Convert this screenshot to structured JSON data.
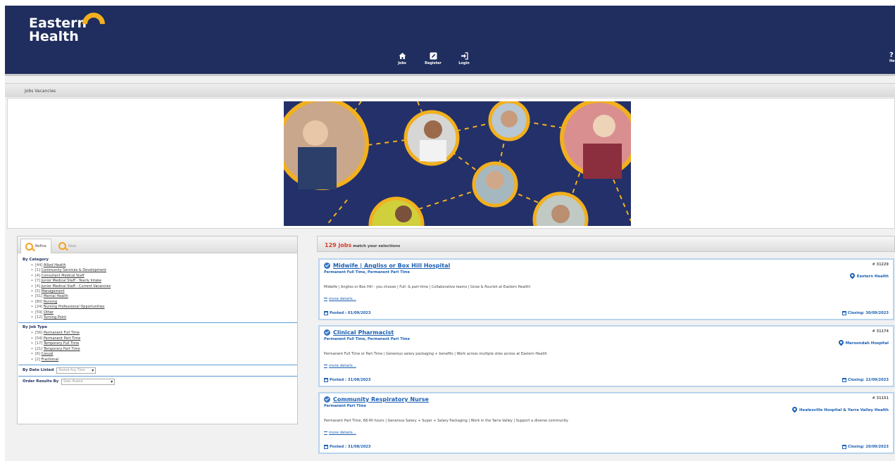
{
  "brand": {
    "line1": "Eastern",
    "line2": "Health",
    "accent": "#f2b01e",
    "navy": "#1f2e5e"
  },
  "nav": [
    {
      "label": "Jobs",
      "icon": "home-icon"
    },
    {
      "label": "Register",
      "icon": "edit-icon"
    },
    {
      "label": "Login",
      "icon": "login-icon"
    }
  ],
  "help": {
    "glyph": "?",
    "label": "He"
  },
  "section": {
    "title": "Jobs Vacancies"
  },
  "filters": {
    "tabs": [
      {
        "label": "Refine"
      },
      {
        "label": "New"
      }
    ],
    "category_head": "By Category",
    "categories": [
      {
        "count": "[44]",
        "label": "Allied Health"
      },
      {
        "count": "[1]",
        "label": "Community Services & Development"
      },
      {
        "count": "[4]",
        "label": "Consultant Medical Staff"
      },
      {
        "count": "[7]",
        "label": "Junior Medical Staff - Yearly Intake"
      },
      {
        "count": "[4]",
        "label": "Junior Medical Staff - Current Vacancies"
      },
      {
        "count": "[5]",
        "label": "Management"
      },
      {
        "count": "[51]",
        "label": "Mental Health"
      },
      {
        "count": "[80]",
        "label": "Nursing"
      },
      {
        "count": "[24]",
        "label": "Nursing Professional Opportunities"
      },
      {
        "count": "[59]",
        "label": "Other"
      },
      {
        "count": "[12]",
        "label": "Turning Point"
      }
    ],
    "jobtype_head": "By Job Type",
    "jobtypes": [
      {
        "count": "[56]",
        "label": "Permanent Full Time"
      },
      {
        "count": "[54]",
        "label": "Permanent Part Time"
      },
      {
        "count": "[17]",
        "label": "Temporary Full Time"
      },
      {
        "count": "[21]",
        "label": "Temporary Part Time"
      },
      {
        "count": "[6]",
        "label": "Casual"
      },
      {
        "count": "[2]",
        "label": "Fractional"
      }
    ],
    "date_listed_label": "By Date Listed",
    "date_listed_value": "Posted Any Time",
    "order_label": "Order Results By",
    "order_value": "Date Posted"
  },
  "results": {
    "count": "129 jobs",
    "suffix": " match your selections"
  },
  "jobs": [
    {
      "title": "Midwife | Angliss or Box Hill Hospital",
      "type": "Permanent Full Time, Permanent Part Time",
      "desc": "Midwife | Angliss or Box Hill - you choose | Full- & part-time | Collaborative teams | Grow & flourish at Eastern Health!",
      "more": "more details...",
      "posted": "Posted : 01/09/2023",
      "closing": "Closing: 30/09/2023",
      "ref": "# 31229",
      "location": "Eastern Health"
    },
    {
      "title": "Clinical Pharmacist",
      "type": "Permanent Full Time, Permanent Part Time",
      "desc": "Permanent Full Time or Part Time | Generous salary packaging + benefits | Work across multiple sites across at Eastern Health",
      "more": "more details...",
      "posted": "Posted : 31/08/2023",
      "closing": "Closing: 22/09/2023",
      "ref": "# 31174",
      "location": "Maroondah Hospital"
    },
    {
      "title": "Community Respiratory Nurse",
      "type": "Permanent Part Time",
      "desc": "Permanent Part Time, 68.40 hours | Generous Salary + Super + Salary Packaging | Work in the Yarra Valley | Support a diverse community",
      "more": "more details...",
      "posted": "Posted : 31/08/2023",
      "closing": "Closing: 20/09/2023",
      "ref": "# 31151",
      "location": "Healesville Hospital & Yarra Valley Health"
    }
  ]
}
